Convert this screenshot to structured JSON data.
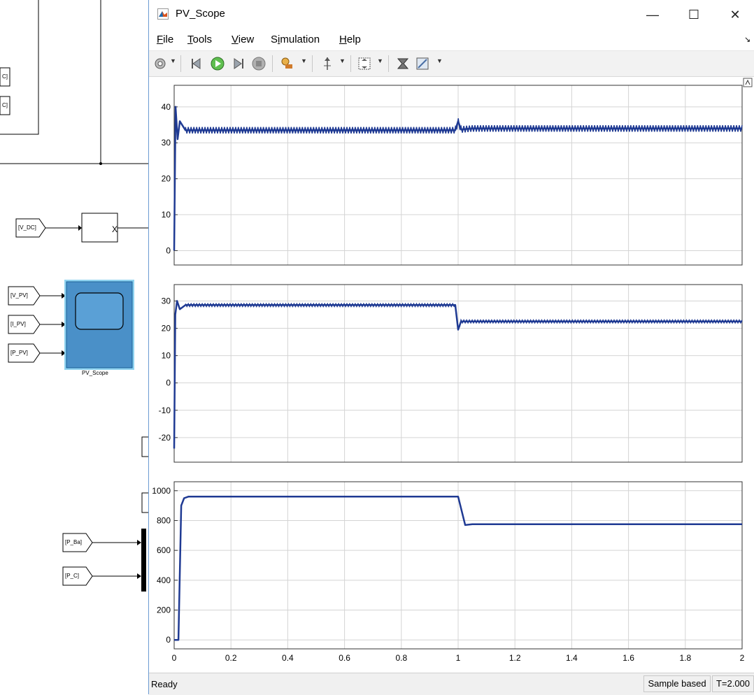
{
  "canvas": {
    "tags": [
      {
        "label": "[V_DC]"
      },
      {
        "label": "[V_PV]"
      },
      {
        "label": "[I_PV]"
      },
      {
        "label": "[P_PV]"
      },
      {
        "label": "[P_Ba]"
      },
      {
        "label": "[P_C]"
      }
    ],
    "partial_labels": [
      "C]",
      "C]"
    ],
    "scope_block_label": "PV_Scope"
  },
  "window": {
    "title": "PV_Scope",
    "menu": [
      {
        "label": "File",
        "key": "F",
        "rest": "ile"
      },
      {
        "label": "Tools",
        "key": "T",
        "rest": "ools"
      },
      {
        "label": "View",
        "key": "V",
        "rest": "iew"
      },
      {
        "label": "Simulation",
        "key": "i",
        "pre": "S",
        "rest": "mulation"
      },
      {
        "label": "Help",
        "key": "H",
        "rest": "elp"
      }
    ],
    "toolbar_icons": [
      "settings-icon",
      "step-back-icon",
      "run-icon",
      "step-forward-icon",
      "stop-icon",
      "highlight-icon",
      "cursor-icon",
      "zoom-fit-icon",
      "export-icon",
      "style-icon"
    ]
  },
  "chart_data": [
    {
      "type": "line",
      "x_range": [
        0,
        2
      ],
      "ylim": [
        -4,
        46
      ],
      "yticks": [
        "0",
        "10",
        "20",
        "30",
        "40"
      ],
      "grid": true,
      "series": [
        {
          "color": "#1f3a93",
          "x": [
            0,
            0.005,
            0.012,
            0.02,
            0.04,
            0.1,
            0.5,
            0.99,
            1.0,
            1.01,
            1.05,
            1.5,
            2.0
          ],
          "values": [
            0,
            40,
            31,
            36,
            33.5,
            33.5,
            33.5,
            33.5,
            36,
            33.7,
            34,
            34,
            34
          ]
        }
      ]
    },
    {
      "type": "line",
      "x_range": [
        0,
        2
      ],
      "ylim": [
        -29,
        36
      ],
      "yticks": [
        "-20",
        "-10",
        "0",
        "10",
        "20",
        "30"
      ],
      "grid": true,
      "series": [
        {
          "color": "#1f3a93",
          "x": [
            0,
            0.004,
            0.01,
            0.02,
            0.04,
            0.1,
            0.5,
            0.99,
            1.0,
            1.01,
            1.03,
            1.5,
            2.0
          ],
          "values": [
            -24,
            25,
            30,
            27,
            28.5,
            28.5,
            28.5,
            28.5,
            19.5,
            22.5,
            22.5,
            22.5,
            22.5
          ]
        }
      ]
    },
    {
      "type": "line",
      "x_range": [
        0,
        2
      ],
      "ylim": [
        -60,
        1060
      ],
      "yticks": [
        "0",
        "200",
        "400",
        "600",
        "800",
        "1000"
      ],
      "xticks": [
        "0",
        "0.2",
        "0.4",
        "0.6",
        "0.8",
        "1",
        "1.2",
        "1.4",
        "1.6",
        "1.8",
        "2"
      ],
      "grid": true,
      "series": [
        {
          "color": "#1f3a93",
          "x": [
            0,
            0.015,
            0.025,
            0.035,
            0.05,
            0.1,
            0.5,
            1.0,
            1.025,
            1.05,
            1.5,
            2.0
          ],
          "values": [
            0,
            0,
            900,
            950,
            960,
            960,
            960,
            960,
            770,
            775,
            775,
            775
          ]
        }
      ]
    }
  ],
  "status": {
    "text": "Ready",
    "sample_mode": "Sample based",
    "time": "T=2.000"
  }
}
